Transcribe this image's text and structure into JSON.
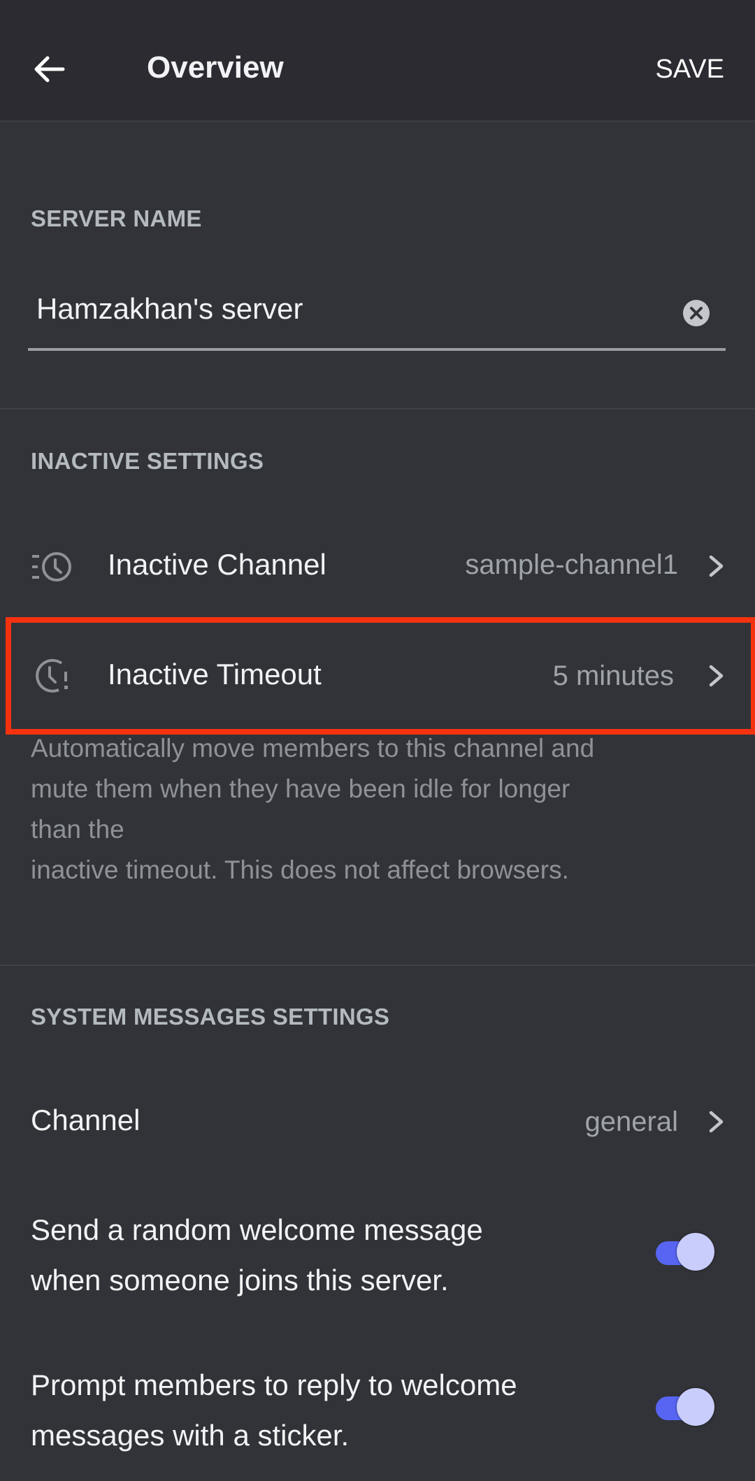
{
  "header": {
    "title": "Overview",
    "save_label": "SAVE",
    "back_icon": "arrow-left-icon"
  },
  "server_name": {
    "section_label": "SERVER NAME",
    "value": "Hamzakhan's server",
    "clear_icon": "clear-circle-icon"
  },
  "inactive": {
    "section_label": "INACTIVE SETTINGS",
    "rows": [
      {
        "icon": "inactive-channel-icon",
        "label": "Inactive Channel",
        "value": "sample-channel1"
      },
      {
        "icon": "inactive-timeout-icon",
        "label": "Inactive Timeout",
        "value": "5 minutes"
      }
    ],
    "description_lines": [
      "Automatically move members to this channel and",
      "mute them when they have been idle for longer",
      "than the",
      "inactive timeout. This does not affect browsers."
    ],
    "highlight_color": "#f5320f"
  },
  "system_messages": {
    "section_label": "SYSTEM MESSAGES SETTINGS",
    "channel_label": "Channel",
    "channel_value": "general",
    "toggles": [
      {
        "lines": [
          "Send a random welcome message",
          "when someone joins this server."
        ],
        "enabled": true
      },
      {
        "lines": [
          "Prompt members to reply to welcome",
          "messages with a sticker."
        ],
        "enabled": true
      }
    ],
    "accent_color": "#5865f2"
  }
}
